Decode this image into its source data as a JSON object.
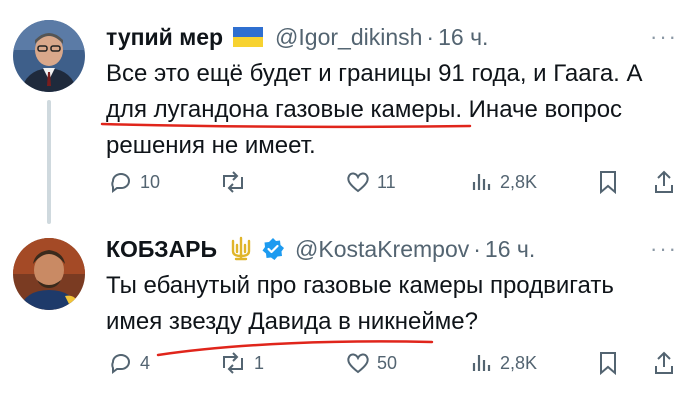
{
  "tweets": [
    {
      "name": "тупий мер",
      "flag": "ukraine-flag",
      "handle": "@Igor_dikinsh",
      "dot": "·",
      "time": "16 ч.",
      "text_lines": [
        "Все это ещё будет и границы 91 года, и Гаага. А",
        "для лугандона газовые камеры. Иначе вопрос",
        "решения не имеет."
      ],
      "replies": "10",
      "retweets": "",
      "likes": "11",
      "views": "2,8K"
    },
    {
      "name": "КОБЗАРЬ",
      "emblem": "trident-emblem",
      "verified": "verified-badge",
      "handle": "@KostaKrempov",
      "dot": "·",
      "time": "16 ч.",
      "text_lines": [
        "Ты ебанутый про газовые камеры продвигать",
        "имея звезду Давида в никнейме?"
      ],
      "replies": "4",
      "retweets": "1",
      "likes": "50",
      "views": "2,8K"
    }
  ],
  "more_label": "···",
  "colors": {
    "text": "#0f1419",
    "secondary": "#536471",
    "verified": "#1d9bf0",
    "annotation": "#e0251b",
    "flag_blue": "#2f6fd0",
    "flag_yellow": "#f7d230"
  }
}
